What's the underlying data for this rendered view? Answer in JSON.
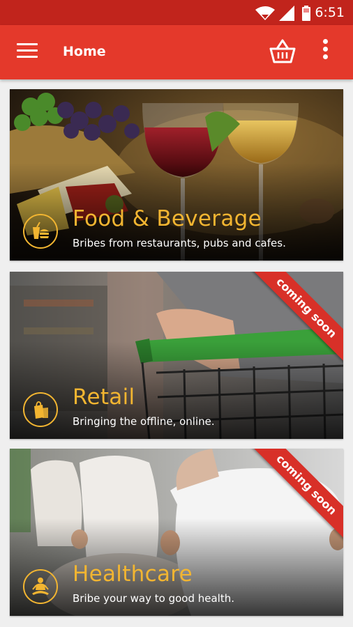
{
  "status_bar": {
    "time": "6:51"
  },
  "app_bar": {
    "title": "Home"
  },
  "cards": [
    {
      "title": "Food & Beverage",
      "subtitle": "Bribes from restaurants, pubs and cafes.",
      "icon": "drink-burger-icon",
      "badge": ""
    },
    {
      "title": "Retail",
      "subtitle": "Bringing the offline, online.",
      "icon": "shopping-bag-icon",
      "badge": "coming soon"
    },
    {
      "title": "Healthcare",
      "subtitle": "Bribe your way to good health.",
      "icon": "meditation-icon",
      "badge": "coming soon"
    }
  ],
  "colors": {
    "status_bar": "#c1241c",
    "app_bar": "#e4392b",
    "accent_gold": "#f2b531",
    "ribbon": "#d83028",
    "background": "#efefef"
  }
}
